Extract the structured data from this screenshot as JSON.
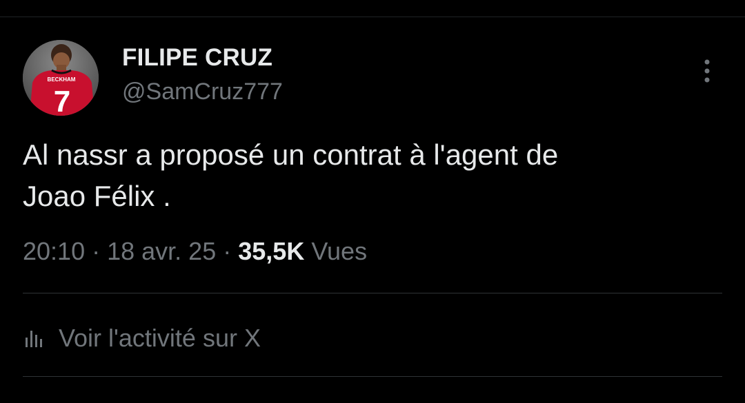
{
  "tweet": {
    "display_name": "FILIPE CRUZ",
    "handle": "@SamCruz777",
    "text_line1": "Al nassr a proposé un contrat à l'agent de",
    "text_line2": "Joao Félix .",
    "time": "20:10",
    "date": "18 avr. 25",
    "separator": "·",
    "views_count": "35,5K",
    "views_label": "Vues",
    "activity_label": "Voir l'activité sur X",
    "avatar_jersey_name": "BECKHAM",
    "avatar_jersey_number": "7"
  },
  "icons": {
    "more": "more-vertical-icon",
    "activity": "bar-chart-icon"
  },
  "colors": {
    "background": "#000000",
    "primary_text": "#e7e9ea",
    "secondary_text": "#71767b",
    "divider": "#2f3336",
    "jersey_red": "#c8102e"
  }
}
